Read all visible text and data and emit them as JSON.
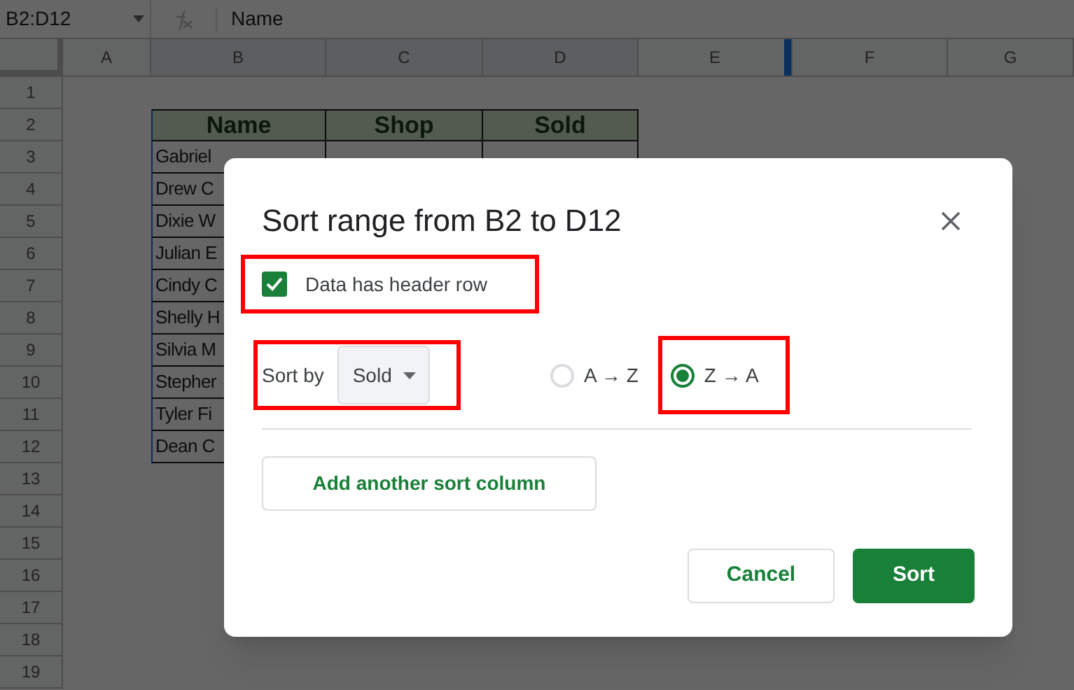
{
  "sheet": {
    "name_box": "B2:D12",
    "formula": "Name",
    "columns": [
      "A",
      "B",
      "C",
      "D",
      "E",
      "F",
      "G"
    ],
    "rows": [
      "1",
      "2",
      "3",
      "4",
      "5",
      "6",
      "7",
      "8",
      "9",
      "10",
      "11",
      "12",
      "13",
      "14",
      "15",
      "16",
      "17",
      "18",
      "19"
    ],
    "header": [
      "Name",
      "Shop",
      "Sold"
    ],
    "names": [
      "Gabriel",
      "Drew C",
      "Dixie W",
      "Julian E",
      "Cindy C",
      "Shelly H",
      "Silvia M",
      "Stepher",
      "Tyler Fi",
      "Dean C"
    ]
  },
  "dialog": {
    "title": "Sort range from B2 to D12",
    "header_row": {
      "label": "Data has header row",
      "checked": true
    },
    "sort_by": {
      "label": "Sort by",
      "value": "Sold"
    },
    "order": [
      {
        "label": "A → Z",
        "selected": false
      },
      {
        "label": "Z → A",
        "selected": true
      }
    ],
    "add_button": "Add another sort column",
    "buttons": {
      "cancel": "Cancel",
      "sort": "Sort"
    }
  }
}
